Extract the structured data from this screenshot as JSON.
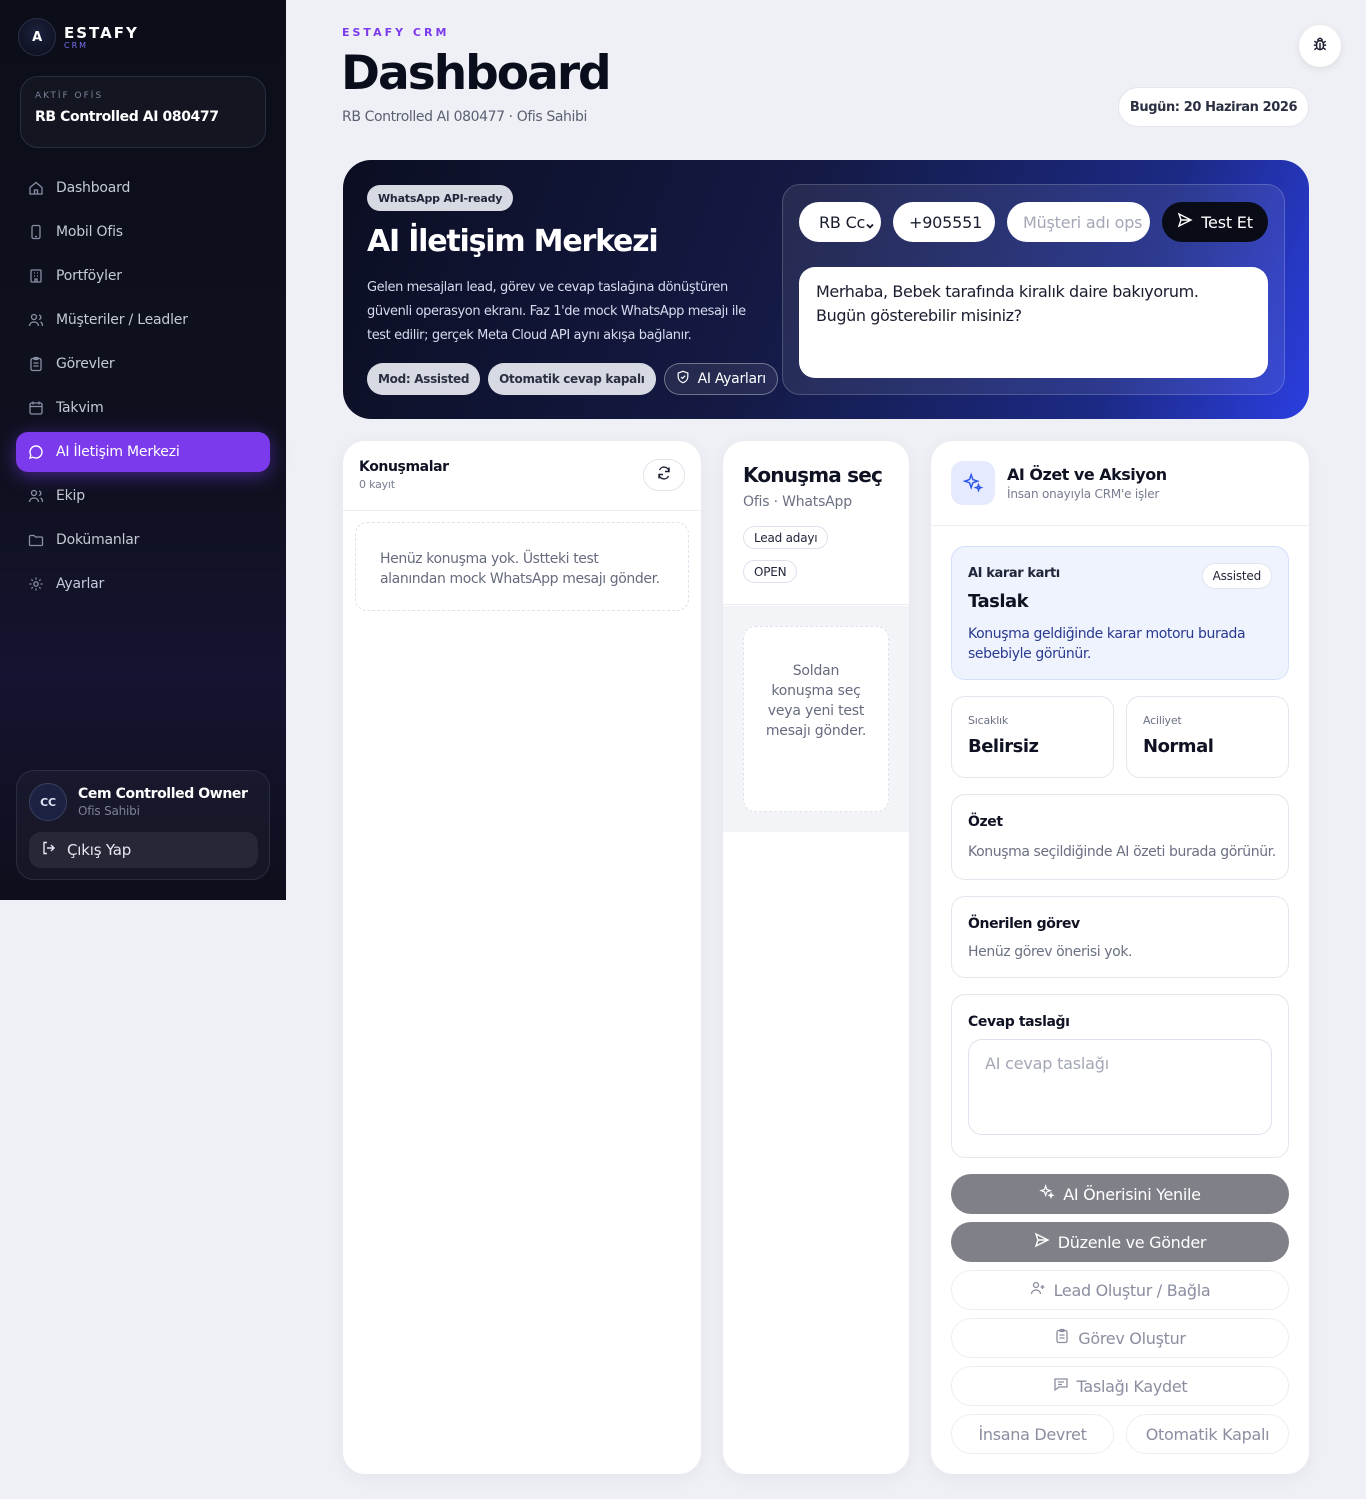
{
  "brand": {
    "name": "ESTAFY",
    "sub": "CRM",
    "logo_icon": "A"
  },
  "office": {
    "label": "AKTİF OFİS",
    "value": "RB Controlled AI 080477"
  },
  "nav": [
    {
      "label": "Dashboard",
      "icon": "home-icon"
    },
    {
      "label": "Mobil Ofis",
      "icon": "phone-icon"
    },
    {
      "label": "Portföyler",
      "icon": "building-icon"
    },
    {
      "label": "Müşteriler / Leadler",
      "icon": "users-icon"
    },
    {
      "label": "Görevler",
      "icon": "clipboard-icon"
    },
    {
      "label": "Takvim",
      "icon": "calendar-icon"
    },
    {
      "label": "AI İletişim Merkezi",
      "icon": "chat-icon",
      "active": true
    },
    {
      "label": "Ekip",
      "icon": "team-icon"
    },
    {
      "label": "Dokümanlar",
      "icon": "folder-icon"
    },
    {
      "label": "Ayarlar",
      "icon": "gear-icon"
    }
  ],
  "user": {
    "initials": "CC",
    "name": "Cem Controlled Owner",
    "role": "Ofis Sahibi",
    "logout_label": "Çıkış Yap"
  },
  "header": {
    "eyebrow": "ESTAFY CRM",
    "title": "Dashboard",
    "subtitle": "RB Controlled AI 080477 · Ofis Sahibi",
    "date": "Bugün: 20 Haziran 2026"
  },
  "hero": {
    "badge": "WhatsApp API-ready",
    "title": "AI İletişim Merkezi",
    "description": "Gelen mesajları lead, görev ve cevap taslağına dönüştüren güvenli operasyon ekranı. Faz 1'de mock WhatsApp mesajı ile test edilir; gerçek Meta Cloud API aynı akışa bağlanır.",
    "mode_chip": "Mod: Assisted",
    "auto_chip": "Otomatik cevap kapalı",
    "settings_label": "AI Ayarları",
    "test": {
      "office_select": "RB Cc",
      "phone_value": "+905551",
      "name_placeholder": "Müşteri adı ops",
      "test_button": "Test Et",
      "message": "Merhaba, Bebek tarafında kiralık daire bakıyorum. Bugün gösterebilir misiniz?"
    }
  },
  "conversations": {
    "title": "Konuşmalar",
    "count": "0 kayıt",
    "empty": "Henüz konuşma yok. Üstteki test alanından mock WhatsApp mesajı gönder."
  },
  "detail": {
    "title": "Konuşma seç",
    "sub": "Ofis · WhatsApp",
    "badge_lead": "Lead adayı",
    "badge_status": "OPEN",
    "empty": "Soldan konuşma seç veya yeni test mesajı gönder."
  },
  "ai": {
    "title": "AI Özet ve Aksiyon",
    "sub": "İnsan onayıyla CRM'e işler",
    "decision": {
      "label": "AI karar kartı",
      "badge": "Assisted",
      "value": "Taslak",
      "text": "Konuşma geldiğinde karar motoru burada sebebiyle görünür."
    },
    "heat": {
      "label": "Sıcaklık",
      "value": "Belirsiz"
    },
    "urgency": {
      "label": "Aciliyet",
      "value": "Normal"
    },
    "summary": {
      "title": "Özet",
      "text": "Konuşma seçildiğinde AI özeti burada görünür."
    },
    "task": {
      "title": "Önerilen görev",
      "text": "Henüz görev önerisi yok."
    },
    "draft": {
      "title": "Cevap taslağı",
      "placeholder": "AI cevap taslağı"
    },
    "buttons": {
      "refresh": "AI Önerisini Yenile",
      "edit_send": "Düzenle ve Gönder",
      "lead": "Lead Oluştur / Bağla",
      "task": "Görev Oluştur",
      "save": "Taslağı Kaydet",
      "handoff": "İnsana Devret",
      "auto_off": "Otomatik Kapalı"
    }
  },
  "colors": {
    "accent": "#7c3aed",
    "sidebar": "#0b0d18",
    "hero_end": "#2b3ee0"
  }
}
